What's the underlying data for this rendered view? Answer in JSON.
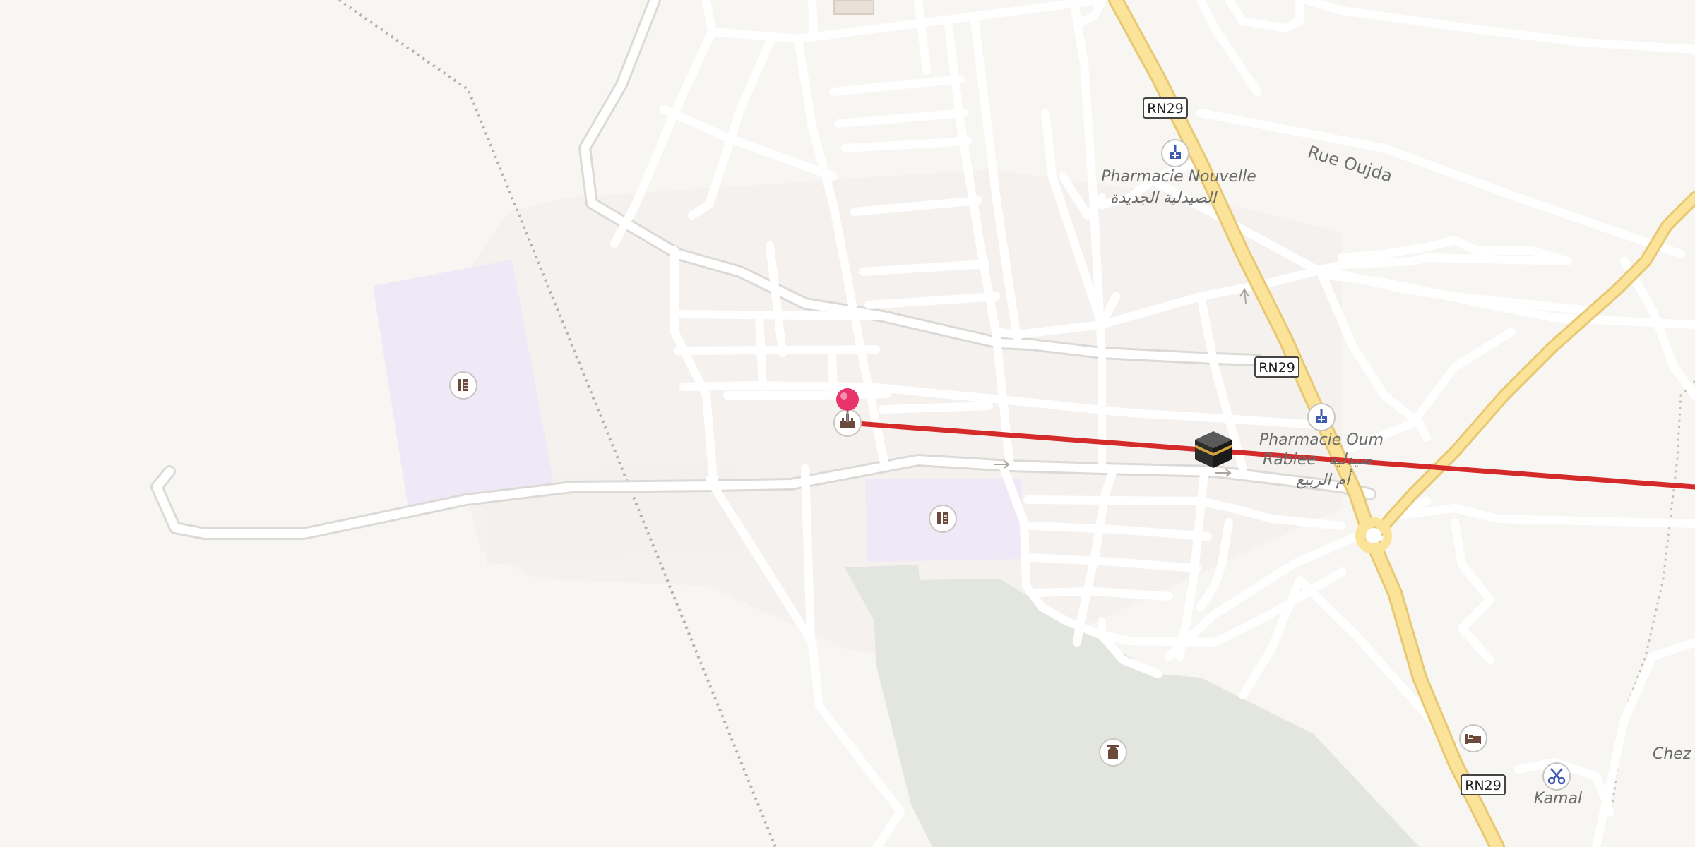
{
  "map": {
    "road_refs": [
      "RN29",
      "RN29",
      "RN29"
    ],
    "streets": [
      "Rue Oujda"
    ],
    "pois": [
      {
        "name_fr": "Pharmacie Nouvelle",
        "name_ar": "الصيدلية الجديدة",
        "icon": "pharmacy-icon"
      },
      {
        "name_fr": "Pharmacie Oum",
        "name_fr2": "Rabiee",
        "name_ar": "صيدلية",
        "name_ar2": "أم الربيع",
        "icon": "pharmacy-icon"
      },
      {
        "name": "Kamal",
        "icon": "hairdresser-scissors-icon"
      },
      {
        "name": "Chez A",
        "icon": ""
      }
    ],
    "other_icons": [
      "school-icon",
      "school-icon",
      "mosque-icon",
      "hotel-bed-icon",
      "cemetery-icon",
      "kaaba-qibla-icon",
      "location-pin-icon"
    ],
    "colors": {
      "background": "#f8f6f3",
      "road": "#ffffff",
      "primary_road": "#fbe39a",
      "school_area": "#efe8f7",
      "cemetery_area": "#e2e6df",
      "qibla_line": "#d42a2a",
      "pin": "#e8336b"
    }
  }
}
